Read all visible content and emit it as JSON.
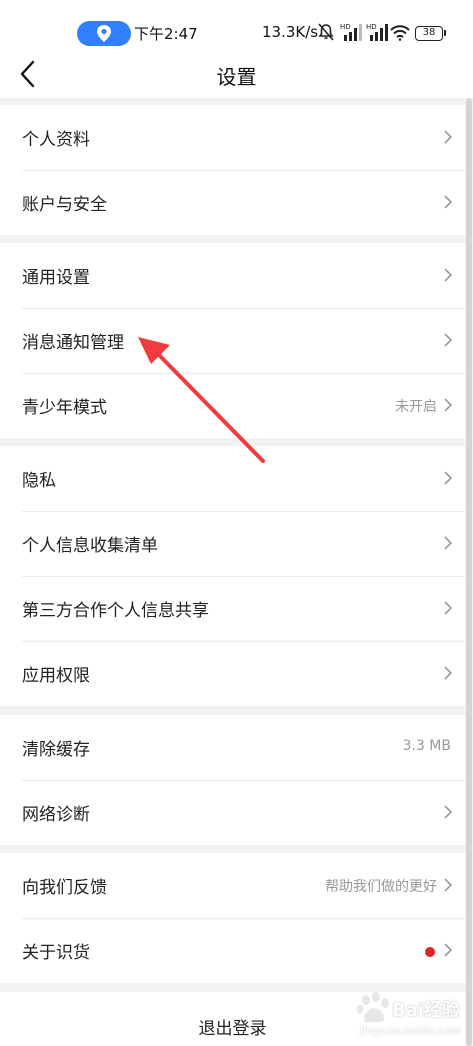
{
  "status_bar": {
    "time": "下午2:47",
    "speed": "13.3K/s",
    "battery": "38",
    "location_color": "#2f7fff"
  },
  "nav": {
    "title": "设置",
    "back_icon": "chevron-left-icon"
  },
  "groups": [
    {
      "items": [
        {
          "label": "个人资料"
        },
        {
          "label": "账户与安全"
        }
      ]
    },
    {
      "items": [
        {
          "label": "通用设置"
        },
        {
          "label": "消息通知管理"
        },
        {
          "label": "青少年模式",
          "value": "未开启"
        }
      ]
    },
    {
      "items": [
        {
          "label": "隐私"
        },
        {
          "label": "个人信息收集清单"
        },
        {
          "label": "第三方合作个人信息共享"
        },
        {
          "label": "应用权限"
        }
      ]
    },
    {
      "items": [
        {
          "label": "清除缓存",
          "value": "3.3 MB"
        },
        {
          "label": "网络诊断"
        }
      ]
    },
    {
      "items": [
        {
          "label": "向我们反馈",
          "value": "帮助我们做的更好"
        },
        {
          "label": "关于识货",
          "badge_color": "#e8231e"
        }
      ]
    }
  ],
  "logout": {
    "label": "退出登录"
  },
  "annotation": {
    "arrow_color": "#f03c3c"
  },
  "watermark": {
    "text": "Bai经验",
    "sub": "jingyan.baidu.com"
  }
}
